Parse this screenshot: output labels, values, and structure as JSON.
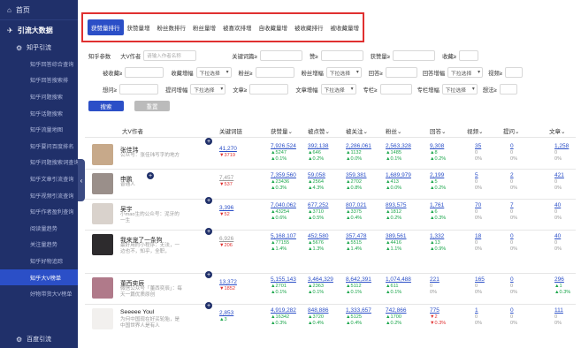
{
  "sidebar": {
    "home": "首页",
    "group": "引流大数据",
    "sub": "知乎引流",
    "items": [
      "知乎回答综合查询",
      "知乎回答搜索排",
      "知乎问题搜索",
      "知乎话题搜索",
      "知乎流量地图",
      "知乎要问百度排名",
      "知乎问题搜索词查询",
      "知乎文章引流查询",
      "知乎视频引流查询",
      "知乎作者盈利查询",
      "阅读量趋势",
      "关注量趋势",
      "知乎好物追踪",
      "知乎大V榜单",
      "好物带货大V榜单"
    ],
    "active_index": 13,
    "bottom": "百度引流"
  },
  "tabs": [
    "获赞量排行",
    "获赞量增",
    "粉丝数排行",
    "粉丝量增",
    "被喜欢排增",
    "自收藏量增",
    "被收藏排行",
    "被收藏量增"
  ],
  "active_tab": 0,
  "filters": {
    "r1": {
      "label_a": "知乎参数",
      "label_b": "大V作者",
      "ph_b": "请输入作者名称",
      "l1": "关键词篇≥",
      "l2": "赞≥",
      "l3": "获赞量≥",
      "l4": "收藏≥"
    },
    "r2": {
      "l1": "被收藏≥",
      "l2": "收藏增幅",
      "s2": "下拉选择",
      "l3": "粉丝≥",
      "l4": "粉丝增幅",
      "s4": "下拉选择",
      "l5": "回答≥",
      "l6": "回答增幅",
      "s6": "下拉选择",
      "l7": "视频≥"
    },
    "r3": {
      "l1": "想问≥",
      "l2": "提问增幅",
      "s2": "下拉选择",
      "l3": "文章≥",
      "l4": "文章增幅",
      "s4": "下拉选择",
      "l5": "专栏≥",
      "l6": "专栏增幅",
      "s6": "下拉选择",
      "l7": "想法≥"
    }
  },
  "buttons": {
    "search": "搜索",
    "reset": "重置"
  },
  "table": {
    "headers": [
      "大V作者",
      "关键词链",
      "获赞量",
      "被点赞",
      "被关注",
      "粉丝",
      "回答",
      "视频",
      "提问",
      "文章"
    ],
    "rows": [
      {
        "name": "张佳玮",
        "desc": "公众号：张佳玮写字的地方",
        "color": "#c7a98a",
        "col1": {
          "v": "41,270",
          "d": "▼3719",
          "dc": "down"
        },
        "cells": [
          {
            "v": "7,926,524",
            "d": "▲5247",
            "p": "▲0.1%",
            "pc": "up"
          },
          {
            "v": "392,138",
            "d": "▲646",
            "p": "▲0.2%",
            "pc": "up"
          },
          {
            "v": "2,286,061",
            "d": "▲1132",
            "p": "▲0.0%",
            "pc": "up"
          },
          {
            "v": "2,563,328",
            "d": "▲1485",
            "p": "▲0.1%",
            "pc": "up"
          },
          {
            "v": "9,308",
            "d": "▲8",
            "p": "▲0.2%",
            "pc": "up"
          }
        ],
        "tail": [
          {
            "v": "35",
            "d": "0",
            "p": "0%"
          },
          {
            "v": "0",
            "d": "0",
            "p": "0%"
          },
          {
            "v": "1,258",
            "d": "0",
            "p": "0%"
          }
        ]
      },
      {
        "name": "申鹏",
        "desc": "普通人",
        "color": "#9a8f8a",
        "col1": {
          "v": "7,457",
          "d": "▼537",
          "dc": "down"
        },
        "cells": [
          {
            "v": "7,359,560",
            "d": "▲23436",
            "p": "▲0.3%",
            "pc": "up"
          },
          {
            "v": "59,058",
            "d": "▲2564",
            "p": "▲4.3%",
            "pc": "up"
          },
          {
            "v": "359,381",
            "d": "▲2702",
            "p": "▲0.8%",
            "pc": "up"
          },
          {
            "v": "1,689,979",
            "d": "▲413",
            "p": "▲0.0%",
            "pc": "up"
          },
          {
            "v": "2,199",
            "d": "▲5",
            "p": "▲0.2%",
            "pc": "up"
          }
        ],
        "tail": [
          {
            "v": "5",
            "d": "0",
            "p": "0%"
          },
          {
            "v": "2",
            "d": "0",
            "p": "0%"
          },
          {
            "v": "421",
            "d": "0",
            "p": "0%"
          }
        ]
      },
      {
        "name": "吴宇",
        "desc": "小mao生的公众号：泥牙的一生",
        "color": "#d9d2cc",
        "col1": {
          "v": "3,396",
          "d": "▼52",
          "dc": "down"
        },
        "cells": [
          {
            "v": "7,040,062",
            "d": "▲43254",
            "p": "▲0.6%",
            "pc": "up"
          },
          {
            "v": "677,252",
            "d": "▲3710",
            "p": "▲0.5%",
            "pc": "up"
          },
          {
            "v": "807,021",
            "d": "▲3375",
            "p": "▲0.4%",
            "pc": "up"
          },
          {
            "v": "893,575",
            "d": "▲1812",
            "p": "▲0.2%",
            "pc": "up"
          },
          {
            "v": "1,761",
            "d": "▲6",
            "p": "▲0.3%",
            "pc": "up"
          }
        ],
        "tail": [
          {
            "v": "70",
            "d": "0",
            "p": "0%"
          },
          {
            "v": "7",
            "d": "0",
            "p": "0%"
          },
          {
            "v": "40",
            "d": "0",
            "p": "0%"
          }
        ]
      },
      {
        "name": "我来宠了一条狗",
        "desc": "最好用的小程序：无法，一边也不，知乎，全职，",
        "color": "#2d2b2d",
        "col1": {
          "v": "6,926",
          "d": "▼206",
          "dc": "down"
        },
        "cells": [
          {
            "v": "5,168,107",
            "d": "▲77155",
            "p": "▲1.4%",
            "pc": "up"
          },
          {
            "v": "452,580",
            "d": "▲5676",
            "p": "▲1.3%",
            "pc": "up"
          },
          {
            "v": "357,478",
            "d": "▲5515",
            "p": "▲1.4%",
            "pc": "up"
          },
          {
            "v": "389,561",
            "d": "▲4416",
            "p": "▲1.1%",
            "pc": "up"
          },
          {
            "v": "1,332",
            "d": "▲13",
            "p": "▲0.9%",
            "pc": "up"
          }
        ],
        "tail": [
          {
            "v": "18",
            "d": "0",
            "p": "0%"
          },
          {
            "v": "0",
            "d": "0",
            "p": "0%"
          },
          {
            "v": "40",
            "d": "0",
            "p": "0%"
          }
        ]
      },
      {
        "name": "董西奕辰",
        "desc": "微信公众号「董西奕辰」：每天一篇优质原创",
        "color": "#b07a8a",
        "col1": {
          "v": "13,372",
          "d": "▼1852",
          "dc": "down"
        },
        "cells": [
          {
            "v": "5,155,143",
            "d": "▲2701",
            "p": "▲0.1%",
            "pc": "up"
          },
          {
            "v": "3,464,329",
            "d": "▲2363",
            "p": "▲0.1%",
            "pc": "up"
          },
          {
            "v": "8,642,391",
            "d": "▲5112",
            "p": "▲0.1%",
            "pc": "up"
          },
          {
            "v": "1,074,488",
            "d": "▲611",
            "p": "▲0.1%",
            "pc": "up"
          },
          {
            "v": "221",
            "d": "0",
            "p": "0%",
            "pc": "na"
          }
        ],
        "tail": [
          {
            "v": "165",
            "d": "0",
            "p": "0%"
          },
          {
            "v": "0",
            "d": "0",
            "p": "0%"
          },
          {
            "v": "296",
            "d": "▲1",
            "p": "▲0.3%"
          }
        ]
      },
      {
        "name": "Seeeee Youl",
        "desc": "为何中国现在好买轮胎，是中国世界人是有人",
        "color": "#f2f0ee",
        "col1": {
          "v": "2,853",
          "d": "▲3",
          "dc": "up"
        },
        "cells": [
          {
            "v": "4,919,282",
            "d": "▲16342",
            "p": "▲0.3%",
            "pc": "up"
          },
          {
            "v": "848,886",
            "d": "▲3720",
            "p": "▲0.4%",
            "pc": "up"
          },
          {
            "v": "1,333,657",
            "d": "▲5125",
            "p": "▲0.4%",
            "pc": "up"
          },
          {
            "v": "742,866",
            "d": "▲1700",
            "p": "▲0.2%",
            "pc": "up"
          },
          {
            "v": "775",
            "d": "▼2",
            "p": "▼0.3%",
            "pc": "down"
          }
        ],
        "tail": [
          {
            "v": "1",
            "d": "0",
            "p": "0%"
          },
          {
            "v": "0",
            "d": "0",
            "p": "0%"
          },
          {
            "v": "111",
            "d": "0",
            "p": "0%"
          }
        ]
      }
    ]
  }
}
